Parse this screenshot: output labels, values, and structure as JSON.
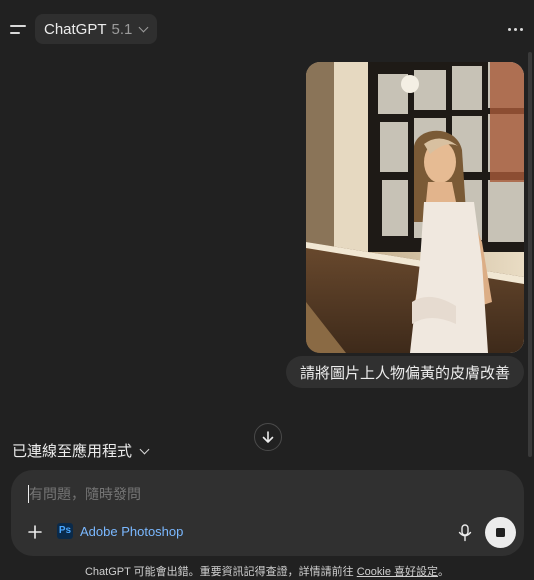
{
  "header": {
    "model_name": "ChatGPT",
    "model_version": "5.1"
  },
  "messages": [
    {
      "role": "user",
      "has_image": true,
      "text": "請將圖片上人物偏黃的皮膚改善"
    }
  ],
  "apps": {
    "label": "已連線至應用程式"
  },
  "composer": {
    "placeholder": "有問題，隨時發問",
    "connected_app": "Adobe Photoshop",
    "connected_app_badge": "Ps"
  },
  "footer": {
    "text": "ChatGPT 可能會出錯。重要資訊記得查證，詳情請前往 ",
    "link": "Cookie 喜好設定",
    "suffix": "。"
  },
  "colors": {
    "background": "#212121",
    "surface": "#303030",
    "text": "#ececec",
    "muted": "#9b9b9b",
    "link_blue": "#7ab8ff"
  }
}
